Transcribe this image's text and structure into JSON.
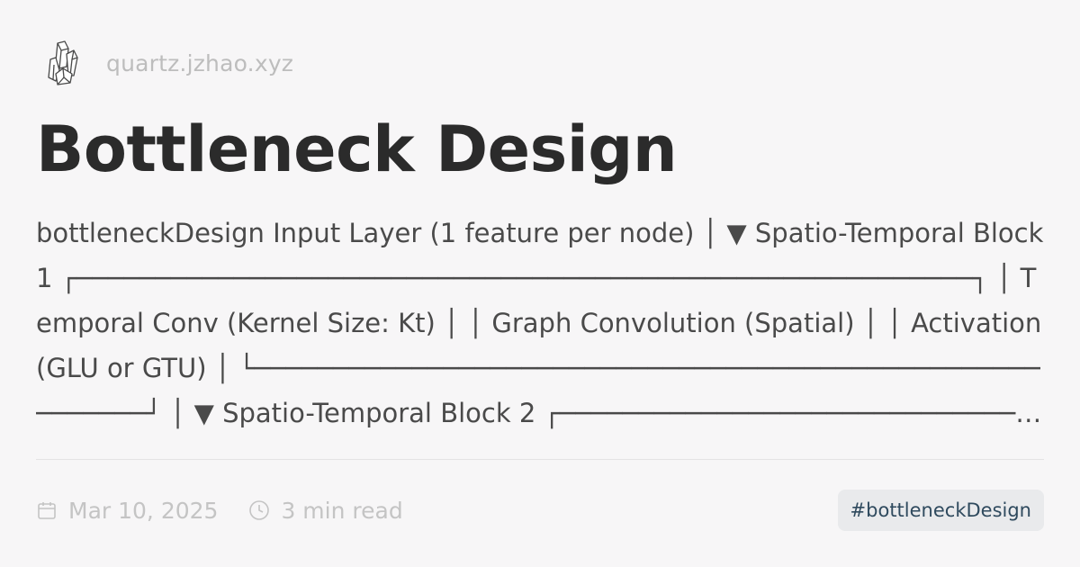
{
  "site": {
    "logo_icon": "crystal-logo-icon",
    "domain": "quartz.jzhao.xyz"
  },
  "page": {
    "title": "Bottleneck Design",
    "description": "bottleneckDesign Input Layer (1 feature per node) │ ▼ Spatio-Temporal Block 1 ┌─────────────────────────────────────────────────────────┐ │ Temporal Conv (Kernel Size: Kt) │ │ Graph Convolution (Spatial) │ │ Activation (GLU or GTU) │ └─────────────────────────────────────────────────────────┘ │ ▼ Spatio-Temporal Block 2 ┌─────────────────────────────────────────────────────────┐"
  },
  "footer": {
    "date_icon": "calendar-icon",
    "date": "Mar 10, 2025",
    "reading_icon": "clock-icon",
    "reading_time": "3 min read",
    "tag": "#bottleneckDesign"
  },
  "colors": {
    "background": "#f7f6f7",
    "title": "#2b2b2b",
    "muted": "#c4c4c4",
    "tag_bg": "#e9eaec",
    "tag_text": "#2f4a5e"
  }
}
